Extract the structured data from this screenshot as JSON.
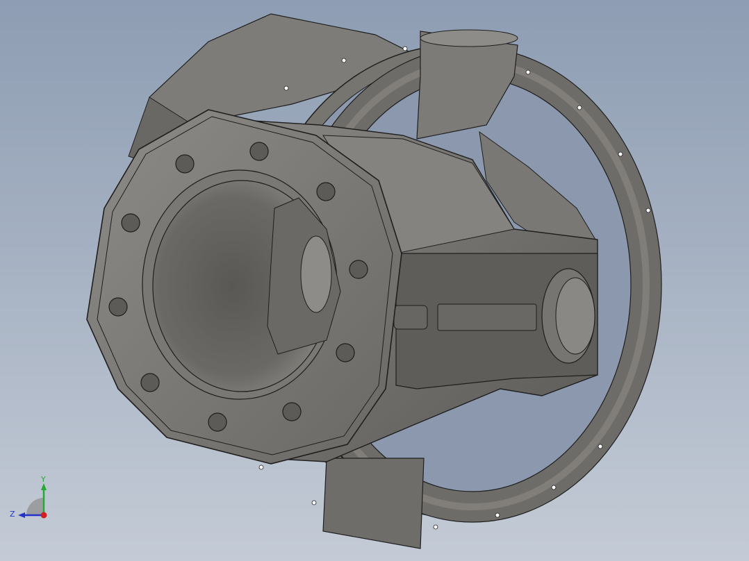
{
  "viewport": {
    "background_top": "#8e9db3",
    "background_bottom": "#c4cbd6"
  },
  "model": {
    "body_color": "#6f6d69",
    "body_light": "#8d8b86",
    "body_dark": "#4f4d4a",
    "edge_color": "#1e1e1e"
  },
  "triad": {
    "x_label": "",
    "y_label": "Y",
    "z_label": "Z",
    "x_color": "#cc2222",
    "y_color": "#22aa33",
    "z_color": "#2233cc"
  }
}
